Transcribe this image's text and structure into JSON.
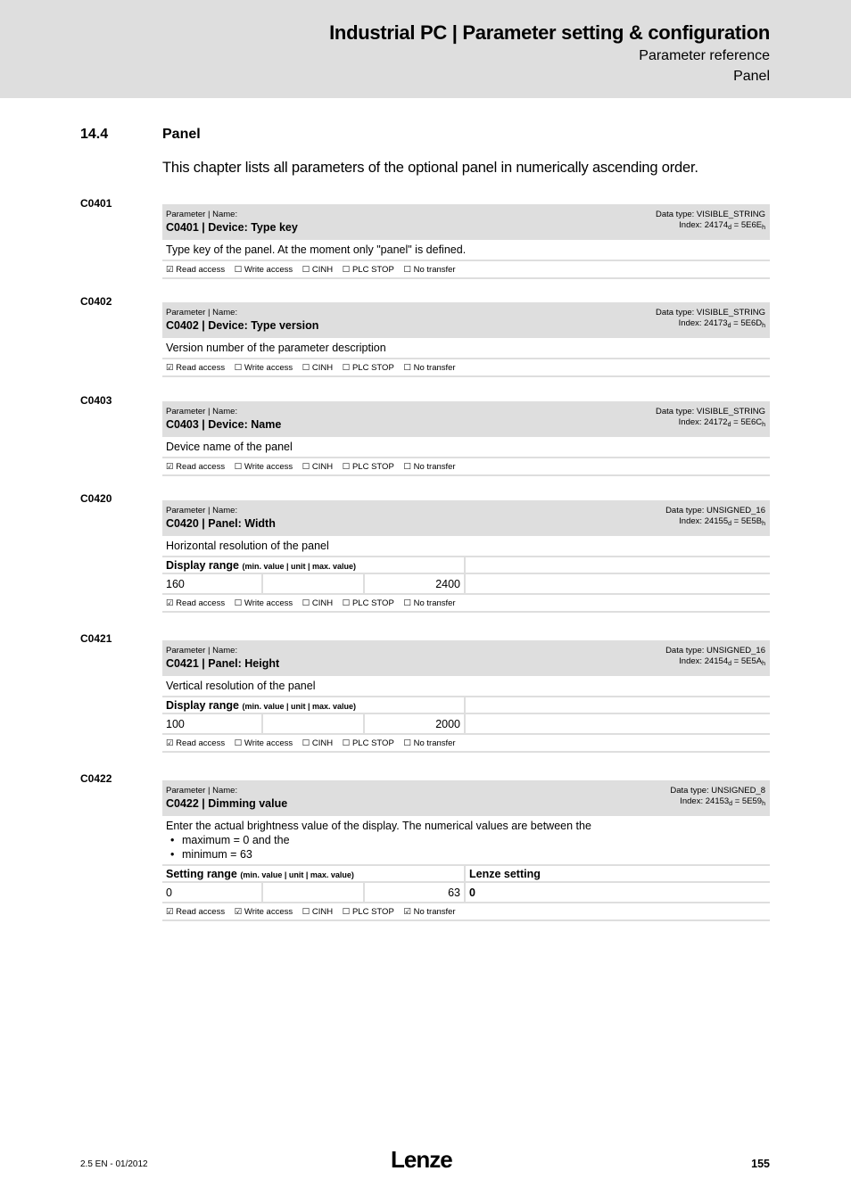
{
  "header": {
    "title": "Industrial PC | Parameter setting & configuration",
    "subtitle1": "Parameter reference",
    "subtitle2": "Panel"
  },
  "section": {
    "number": "14.4",
    "title": "Panel",
    "intro": "This chapter lists all parameters of the optional panel in numerically ascending order."
  },
  "labels": {
    "param_name": "Parameter | Name:",
    "display_range": "Display range",
    "setting_range": "Setting range",
    "range_hint": "(min. value | unit | max. value)",
    "lenze_setting": "Lenze setting",
    "read_access": "Read access",
    "write_access": "Write access",
    "cinh": "CINH",
    "plc_stop": "PLC STOP",
    "no_transfer": "No transfer"
  },
  "params": [
    {
      "code": "C0401",
      "name": "C0401 | Device: Type key",
      "data_type": "Data type: VISIBLE_STRING",
      "index_dec": "24174",
      "index_hex": "5E6E",
      "description": "Type key of the panel. At the moment only \"panel\" is defined.",
      "access": {
        "read": "☑",
        "write": "☐",
        "cinh": "☐",
        "plc_stop": "☐",
        "no_transfer": "☐"
      }
    },
    {
      "code": "C0402",
      "name": "C0402 | Device: Type version",
      "data_type": "Data type: VISIBLE_STRING",
      "index_dec": "24173",
      "index_hex": "5E6D",
      "description": "Version number of the parameter description",
      "access": {
        "read": "☑",
        "write": "☐",
        "cinh": "☐",
        "plc_stop": "☐",
        "no_transfer": "☐"
      }
    },
    {
      "code": "C0403",
      "name": "C0403 | Device: Name",
      "data_type": "Data type: VISIBLE_STRING",
      "index_dec": "24172",
      "index_hex": "5E6C",
      "description": "Device name of the panel",
      "access": {
        "read": "☑",
        "write": "☐",
        "cinh": "☐",
        "plc_stop": "☐",
        "no_transfer": "☐"
      }
    },
    {
      "code": "C0420",
      "name": "C0420 | Panel: Width",
      "data_type": "Data type: UNSIGNED_16",
      "index_dec": "24155",
      "index_hex": "5E5B",
      "description": "Horizontal resolution of the panel",
      "range": {
        "min": "160",
        "unit": "",
        "max": "2400"
      },
      "access": {
        "read": "☑",
        "write": "☐",
        "cinh": "☐",
        "plc_stop": "☐",
        "no_transfer": "☐"
      }
    },
    {
      "code": "C0421",
      "name": "C0421 | Panel: Height",
      "data_type": "Data type: UNSIGNED_16",
      "index_dec": "24154",
      "index_hex": "5E5A",
      "description": "Vertical resolution of the panel",
      "range": {
        "min": "100",
        "unit": "",
        "max": "2000"
      },
      "access": {
        "read": "☑",
        "write": "☐",
        "cinh": "☐",
        "plc_stop": "☐",
        "no_transfer": "☐"
      }
    },
    {
      "code": "C0422",
      "name": "C0422 | Dimming value",
      "data_type": "Data type: UNSIGNED_8",
      "index_dec": "24153",
      "index_hex": "5E59",
      "description": "Enter the actual brightness value of the display. The numerical values are between the",
      "bullets": [
        "maximum =  0 and the",
        "minimum = 63"
      ],
      "range": {
        "min": "0",
        "unit": "",
        "max": "63",
        "lenze_setting": "0"
      },
      "access": {
        "read": "☑",
        "write": "☑",
        "cinh": "☐",
        "plc_stop": "☐",
        "no_transfer": "☑"
      }
    }
  ],
  "footer": {
    "version": "2.5 EN - 01/2012",
    "logo": "Lenze",
    "page": "155"
  }
}
